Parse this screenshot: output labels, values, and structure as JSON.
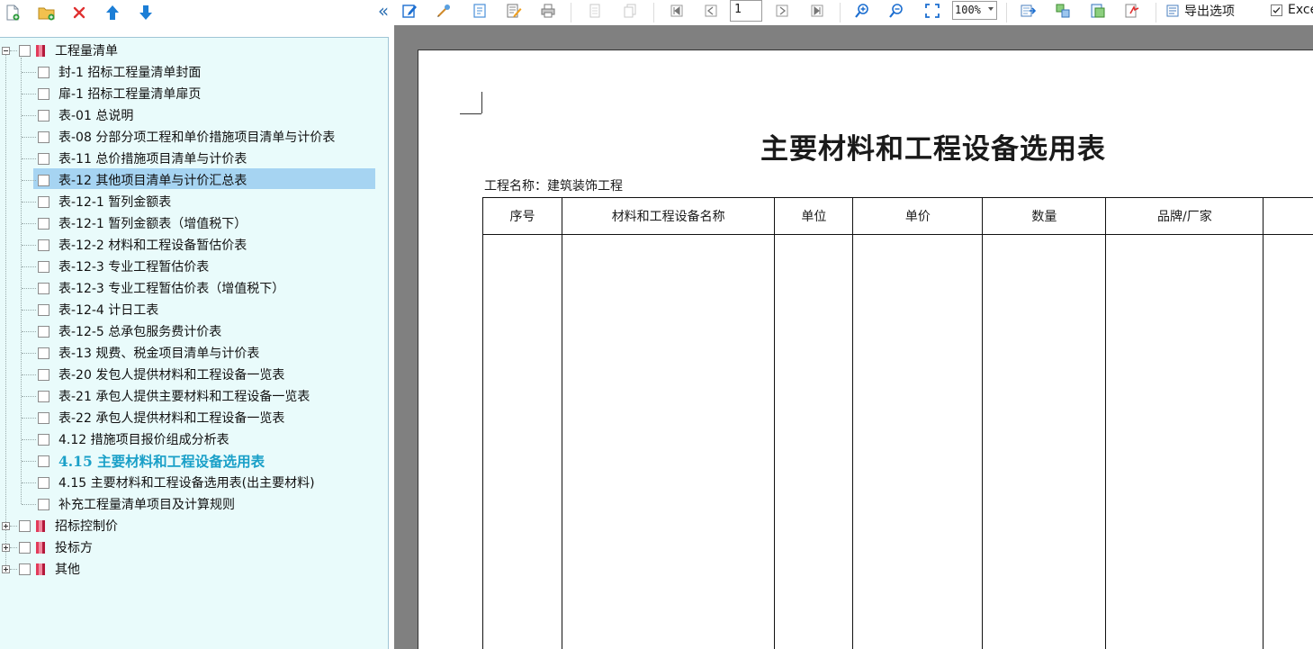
{
  "left_toolbar": {
    "buttons": [
      "new-page-icon",
      "new-folder-icon",
      "delete-icon",
      "move-up-icon",
      "move-down-icon"
    ]
  },
  "right_toolbar": {
    "collapse_glyph": "«",
    "page_number": "1",
    "zoom": "100%",
    "export_label": "导出选项",
    "excel_label": "Excel",
    "excel_checked": true
  },
  "tree": {
    "root": "工程量清单",
    "items": [
      {
        "label": "封-1 招标工程量清单封面"
      },
      {
        "label": "扉-1 招标工程量清单扉页"
      },
      {
        "label": "表-01 总说明"
      },
      {
        "label": "表-08 分部分项工程和单价措施项目清单与计价表"
      },
      {
        "label": "表-11 总价措施项目清单与计价表"
      },
      {
        "label": "表-12 其他项目清单与计价汇总表"
      },
      {
        "label": "表-12-1 暂列金额表"
      },
      {
        "label": "表-12-1 暂列金额表（增值税下）"
      },
      {
        "label": "表-12-2 材料和工程设备暂估价表"
      },
      {
        "label": "表-12-3 专业工程暂估价表"
      },
      {
        "label": "表-12-3 专业工程暂估价表（增值税下）"
      },
      {
        "label": "表-12-4 计日工表"
      },
      {
        "label": "表-12-5 总承包服务费计价表"
      },
      {
        "label": "表-13 规费、税金项目清单与计价表"
      },
      {
        "label": "表-20 发包人提供材料和工程设备一览表"
      },
      {
        "label": "表-21 承包人提供主要材料和工程设备一览表"
      },
      {
        "label": "表-22 承包人提供材料和工程设备一览表"
      },
      {
        "label": "4.12 措施项目报价组成分析表"
      },
      {
        "label": "4.15 主要材料和工程设备选用表"
      },
      {
        "label": "4.15 主要材料和工程设备选用表(出主要材料)"
      },
      {
        "label": "补充工程量清单项目及计算规则"
      }
    ],
    "siblings": [
      "招标控制价",
      "投标方",
      "其他"
    ]
  },
  "report": {
    "title": "主要材料和工程设备选用表",
    "project_label": "工程名称：建筑装饰工程",
    "columns": [
      "序号",
      "材料和工程设备名称",
      "单位",
      "单价",
      "数量",
      "品牌/厂家",
      ""
    ]
  },
  "colors": {
    "tree_bg": "#e9fbfb",
    "selected_bg": "#a6d4f2",
    "active_text": "#1aa0c8",
    "preview_bg": "#808080"
  }
}
